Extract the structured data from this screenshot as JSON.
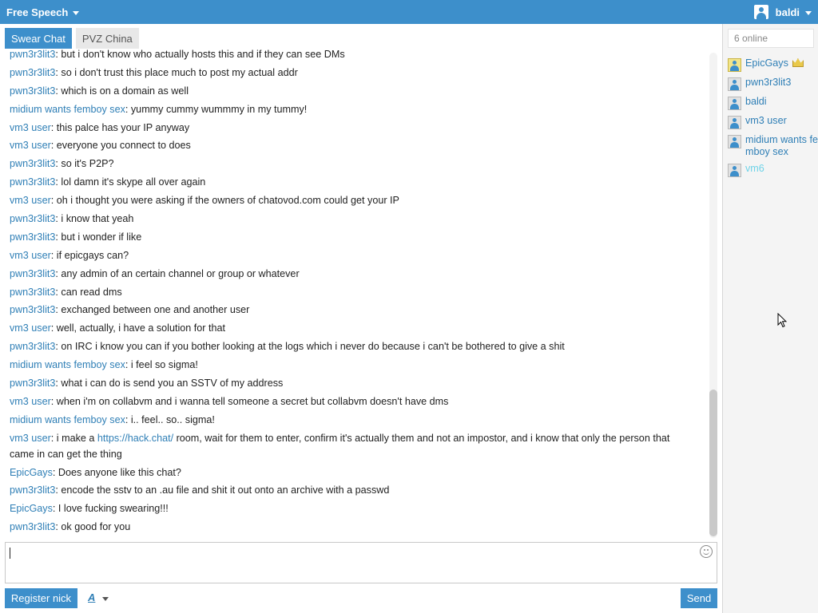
{
  "header": {
    "brand": "Free Speech",
    "username": "baldi"
  },
  "tabs": [
    {
      "label": "Swear Chat",
      "active": true
    },
    {
      "label": "PVZ China",
      "active": false
    }
  ],
  "messages": [
    {
      "nick": "pwn3r3lit3",
      "text": ": but i don't know who actually hosts this and if they can see DMs"
    },
    {
      "nick": "pwn3r3lit3",
      "text": ": so i don't trust this place much to post my actual addr"
    },
    {
      "nick": "pwn3r3lit3",
      "text": ": which is on a domain as well"
    },
    {
      "nick": "midium wants femboy sex",
      "text": ": yummy cummy wummmy in my tummy!"
    },
    {
      "nick": "vm3 user",
      "text": ": this palce has your IP anyway"
    },
    {
      "nick": "vm3 user",
      "text": ": everyone you connect to does"
    },
    {
      "nick": "pwn3r3lit3",
      "text": ": so it's P2P?"
    },
    {
      "nick": "pwn3r3lit3",
      "text": ": lol damn it's skype all over again"
    },
    {
      "nick": "vm3 user",
      "text": ": oh i thought you were asking if the owners of chatovod.com could get your IP"
    },
    {
      "nick": "pwn3r3lit3",
      "text": ": i know that yeah"
    },
    {
      "nick": "pwn3r3lit3",
      "text": ": but i wonder if like"
    },
    {
      "nick": "vm3 user",
      "text": ": if epicgays can?"
    },
    {
      "nick": "pwn3r3lit3",
      "text": ": any admin of an certain channel or group or whatever"
    },
    {
      "nick": "pwn3r3lit3",
      "text": ": can read dms"
    },
    {
      "nick": "pwn3r3lit3",
      "text": ": exchanged between one and another user"
    },
    {
      "nick": "vm3 user",
      "text": ": well, actually, i have a solution for that"
    },
    {
      "nick": "pwn3r3lit3",
      "text": ": on IRC i know you can if you bother looking at the logs which i never do because i can't be bothered to give a shit"
    },
    {
      "nick": "midium wants femboy sex",
      "text": ": i feel so sigma!"
    },
    {
      "nick": "pwn3r3lit3",
      "text": ": what i can do is send you an SSTV of my address"
    },
    {
      "nick": "vm3 user",
      "text": ": when i'm on collabvm and i wanna tell someone a secret but collabvm doesn't have dms"
    },
    {
      "nick": "midium wants femboy sex",
      "text": ": i.. feel.. so.. sigma!"
    },
    {
      "nick": "vm3 user",
      "text": ": i make a ",
      "link": "https://hack.chat/",
      "text2": " room, wait for them to enter, confirm it's actually them and not an impostor, and i know that only the person that came in can get the thing"
    },
    {
      "nick": "EpicGays",
      "text": ": Does anyone like this chat?"
    },
    {
      "nick": "pwn3r3lit3",
      "text": ": encode the sstv to an .au file and shit it out onto an archive with a passwd"
    },
    {
      "nick": "EpicGays",
      "text": ": I love fucking swearing!!!"
    },
    {
      "nick": "pwn3r3lit3",
      "text": ": ok good for you"
    }
  ],
  "composer": {
    "value": ""
  },
  "buttons": {
    "register": "Register nick",
    "font": "A",
    "send": "Send"
  },
  "sidebar": {
    "online_count": "6 online",
    "users": [
      {
        "name": "EpicGays",
        "owner": true
      },
      {
        "name": "pwn3r3lit3",
        "owner": false
      },
      {
        "name": "baldi",
        "owner": false
      },
      {
        "name": "vm3 user",
        "owner": false
      },
      {
        "name": "midium wants femboy sex",
        "owner": false
      },
      {
        "name": "vm6",
        "owner": false,
        "idle": true
      }
    ]
  },
  "colors": {
    "accent": "#3d8fcb",
    "nick": "#2f7fb6",
    "idle_user": "#6fd3e8"
  }
}
